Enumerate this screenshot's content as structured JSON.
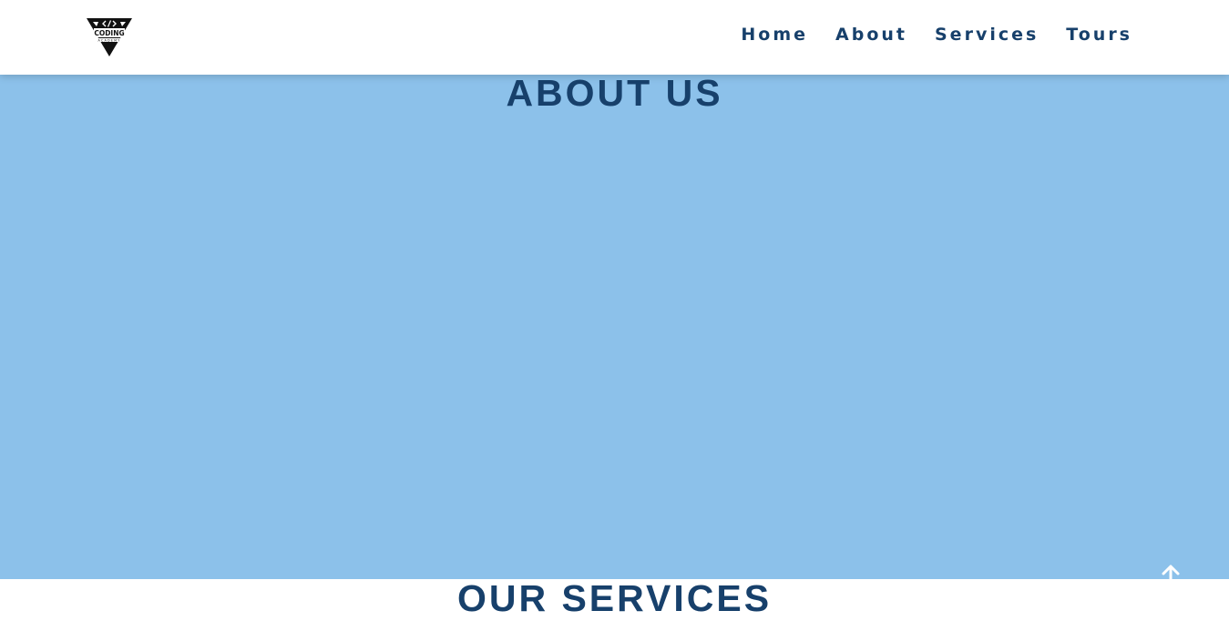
{
  "logo": {
    "name": "coding-logo-icon",
    "text_main": "CODING",
    "text_sub": "ACADEMY"
  },
  "nav": {
    "items": [
      {
        "label": "Home"
      },
      {
        "label": "About"
      },
      {
        "label": "Services"
      },
      {
        "label": "Tours"
      }
    ]
  },
  "about": {
    "title": "ABOUT US",
    "background": "#8cc1ea"
  },
  "services": {
    "title": "OUR SERVICES"
  },
  "colors": {
    "accent_text": "#17406b",
    "nav_background": "#ffffff"
  },
  "scroll_top": {
    "icon": "arrow-up-icon"
  }
}
